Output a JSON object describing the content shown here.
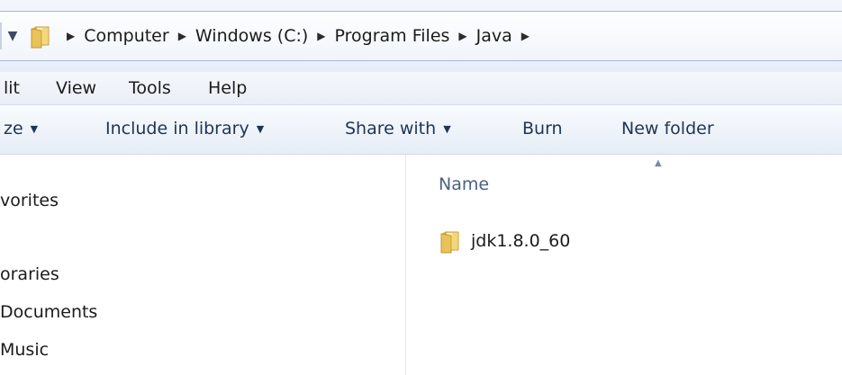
{
  "address_bar": {
    "crumbs": [
      "Computer",
      "Windows (C:)",
      "Program Files",
      "Java"
    ]
  },
  "menu": {
    "items": [
      "lit",
      "View",
      "Tools",
      "Help"
    ]
  },
  "toolbar": {
    "organize": "ze",
    "include_in_library": "Include in library",
    "share_with": "Share with",
    "burn": "Burn",
    "new_folder": "New folder"
  },
  "nav_pane": {
    "items": [
      "vorites",
      "oraries",
      "Documents",
      "Music"
    ]
  },
  "content": {
    "column_name": "Name",
    "files": [
      {
        "name": "jdk1.8.0_60",
        "icon": "folder-icon"
      }
    ]
  },
  "colors": {
    "folder_yellow": "#e9c35a",
    "link_blue": "#1f3552",
    "header_text": "#4d6082"
  }
}
